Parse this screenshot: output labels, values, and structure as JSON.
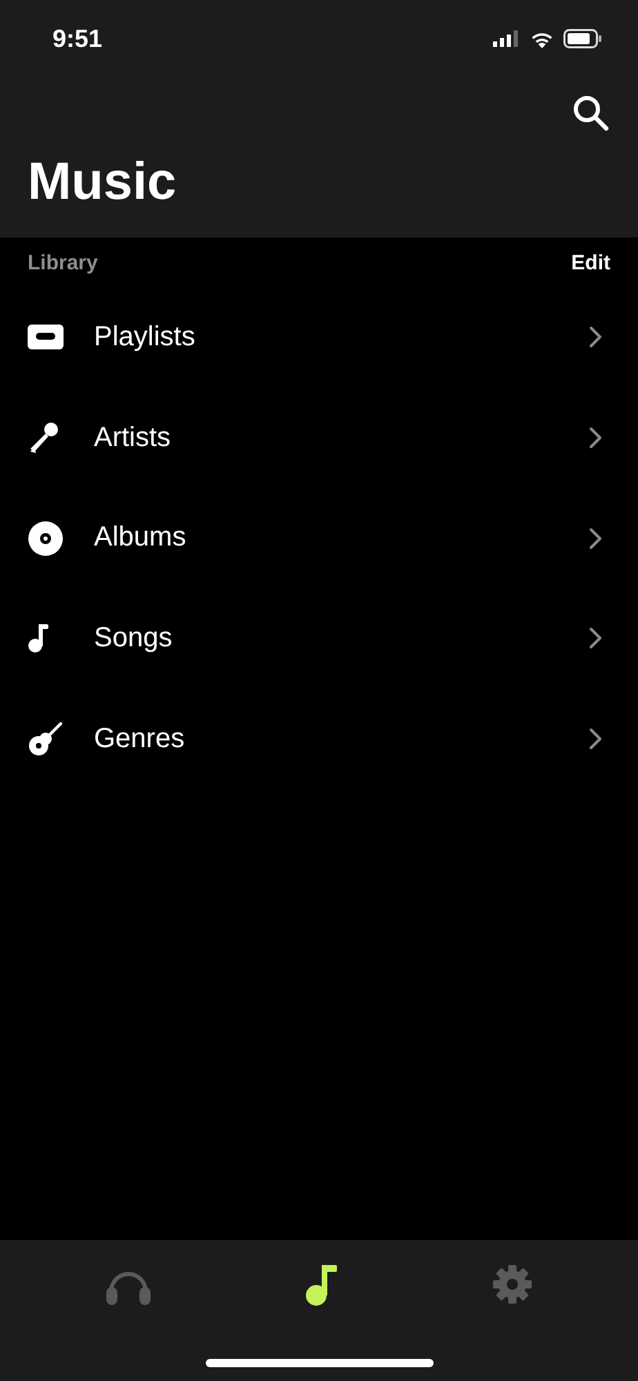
{
  "status_bar": {
    "time": "9:51"
  },
  "header": {
    "title": "Music"
  },
  "library": {
    "label": "Library",
    "action": "Edit",
    "items": [
      {
        "kind": "playlists",
        "label": "Playlists"
      },
      {
        "kind": "artists",
        "label": "Artists"
      },
      {
        "kind": "albums",
        "label": "Albums"
      },
      {
        "kind": "songs",
        "label": "Songs"
      },
      {
        "kind": "genres",
        "label": "Genres"
      }
    ]
  },
  "tab_bar": [
    {
      "kind": "headphones",
      "selected": false
    },
    {
      "kind": "music",
      "selected": true
    },
    {
      "kind": "settings",
      "selected": false
    }
  ]
}
